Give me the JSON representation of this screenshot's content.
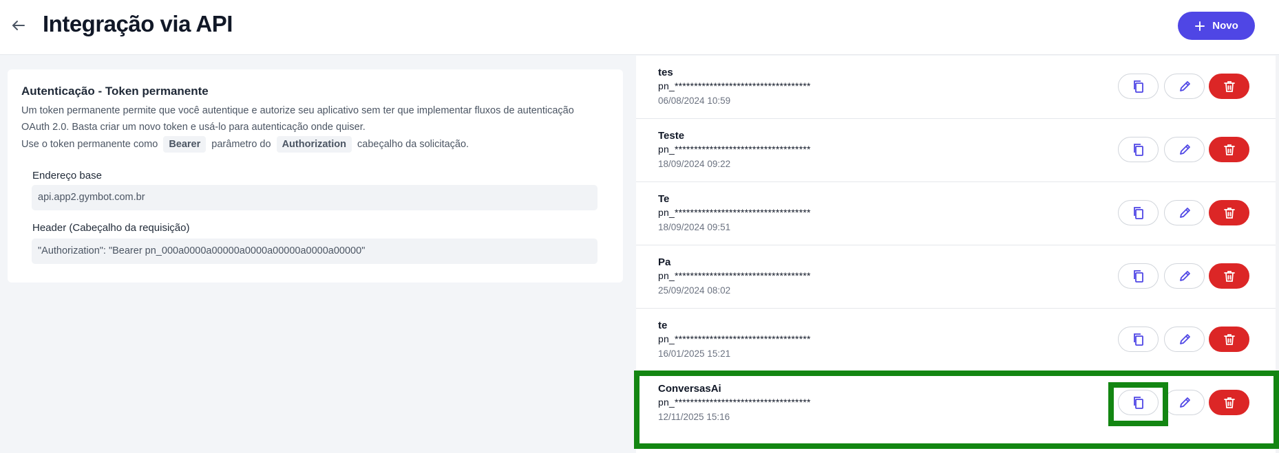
{
  "header": {
    "title": "Integração via API",
    "new_label": "Novo"
  },
  "auth": {
    "title": "Autenticação - Token permanente",
    "desc_line1": "Um token permanente permite que você autentique e autorize seu aplicativo sem ter que implementar fluxos de autenticação",
    "desc_line2": "OAuth 2.0. Basta criar um novo token e usá-lo para autenticação onde quiser.",
    "desc_line3_prefix": "Use o token permanente como",
    "chip_bearer": "Bearer",
    "desc_line3_mid": "parâmetro do",
    "chip_authorization": "Authorization",
    "desc_line3_suffix": "cabeçalho da solicitação.",
    "base_label": "Endereço base",
    "base_value": "api.app2.gymbot.com.br",
    "header_label": "Header (Cabeçalho da requisição)",
    "header_value": "\"Authorization\": \"Bearer pn_000a0000a00000a0000a00000a0000a00000\""
  },
  "tokens": [
    {
      "name": "tes",
      "mask": "pn_***********************************",
      "date": "06/08/2024 10:59"
    },
    {
      "name": "Teste",
      "mask": "pn_***********************************",
      "date": "18/09/2024 09:22"
    },
    {
      "name": "Te",
      "mask": "pn_***********************************",
      "date": "18/09/2024 09:51"
    },
    {
      "name": "Pa",
      "mask": "pn_***********************************",
      "date": "25/09/2024 08:02"
    },
    {
      "name": "te",
      "mask": "pn_***********************************",
      "date": "16/01/2025 15:21"
    },
    {
      "name": "ConversasAi",
      "mask": "pn_***********************************",
      "date": "12/11/2025 15:16"
    }
  ],
  "colors": {
    "primary": "#4f46e5",
    "danger": "#dc2626",
    "highlight": "#138612"
  },
  "icons": {
    "back": "arrow-left-icon",
    "new": "plus-icon",
    "copy": "copy-icon",
    "edit": "pencil-icon",
    "delete": "trash-icon"
  }
}
